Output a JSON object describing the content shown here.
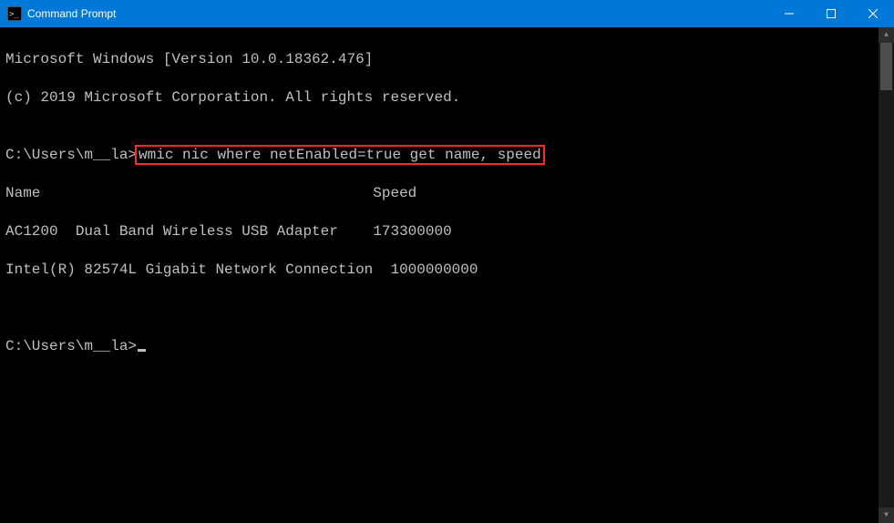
{
  "window": {
    "title": "Command Prompt"
  },
  "terminal": {
    "lines": {
      "l0": "Microsoft Windows [Version 10.0.18362.476]",
      "l1": "(c) 2019 Microsoft Corporation. All rights reserved.",
      "l2": "",
      "prompt1_prefix": "C:\\Users\\m__la>",
      "prompt1_cmd": "wmic nic where netEnabled=true get name, speed",
      "hdr": "Name                                      Speed",
      "row1": "AC1200  Dual Band Wireless USB Adapter    173300000",
      "row2": "Intel(R) 82574L Gigabit Network Connection  1000000000",
      "blank1": "",
      "blank2": "",
      "prompt2_prefix": "C:\\Users\\m__la>"
    }
  },
  "icons": {
    "app": "cmd-icon",
    "minimize": "minimize-icon",
    "maximize": "maximize-icon",
    "close": "close-icon",
    "scroll_up": "scroll-up-icon",
    "scroll_down": "scroll-down-icon"
  }
}
